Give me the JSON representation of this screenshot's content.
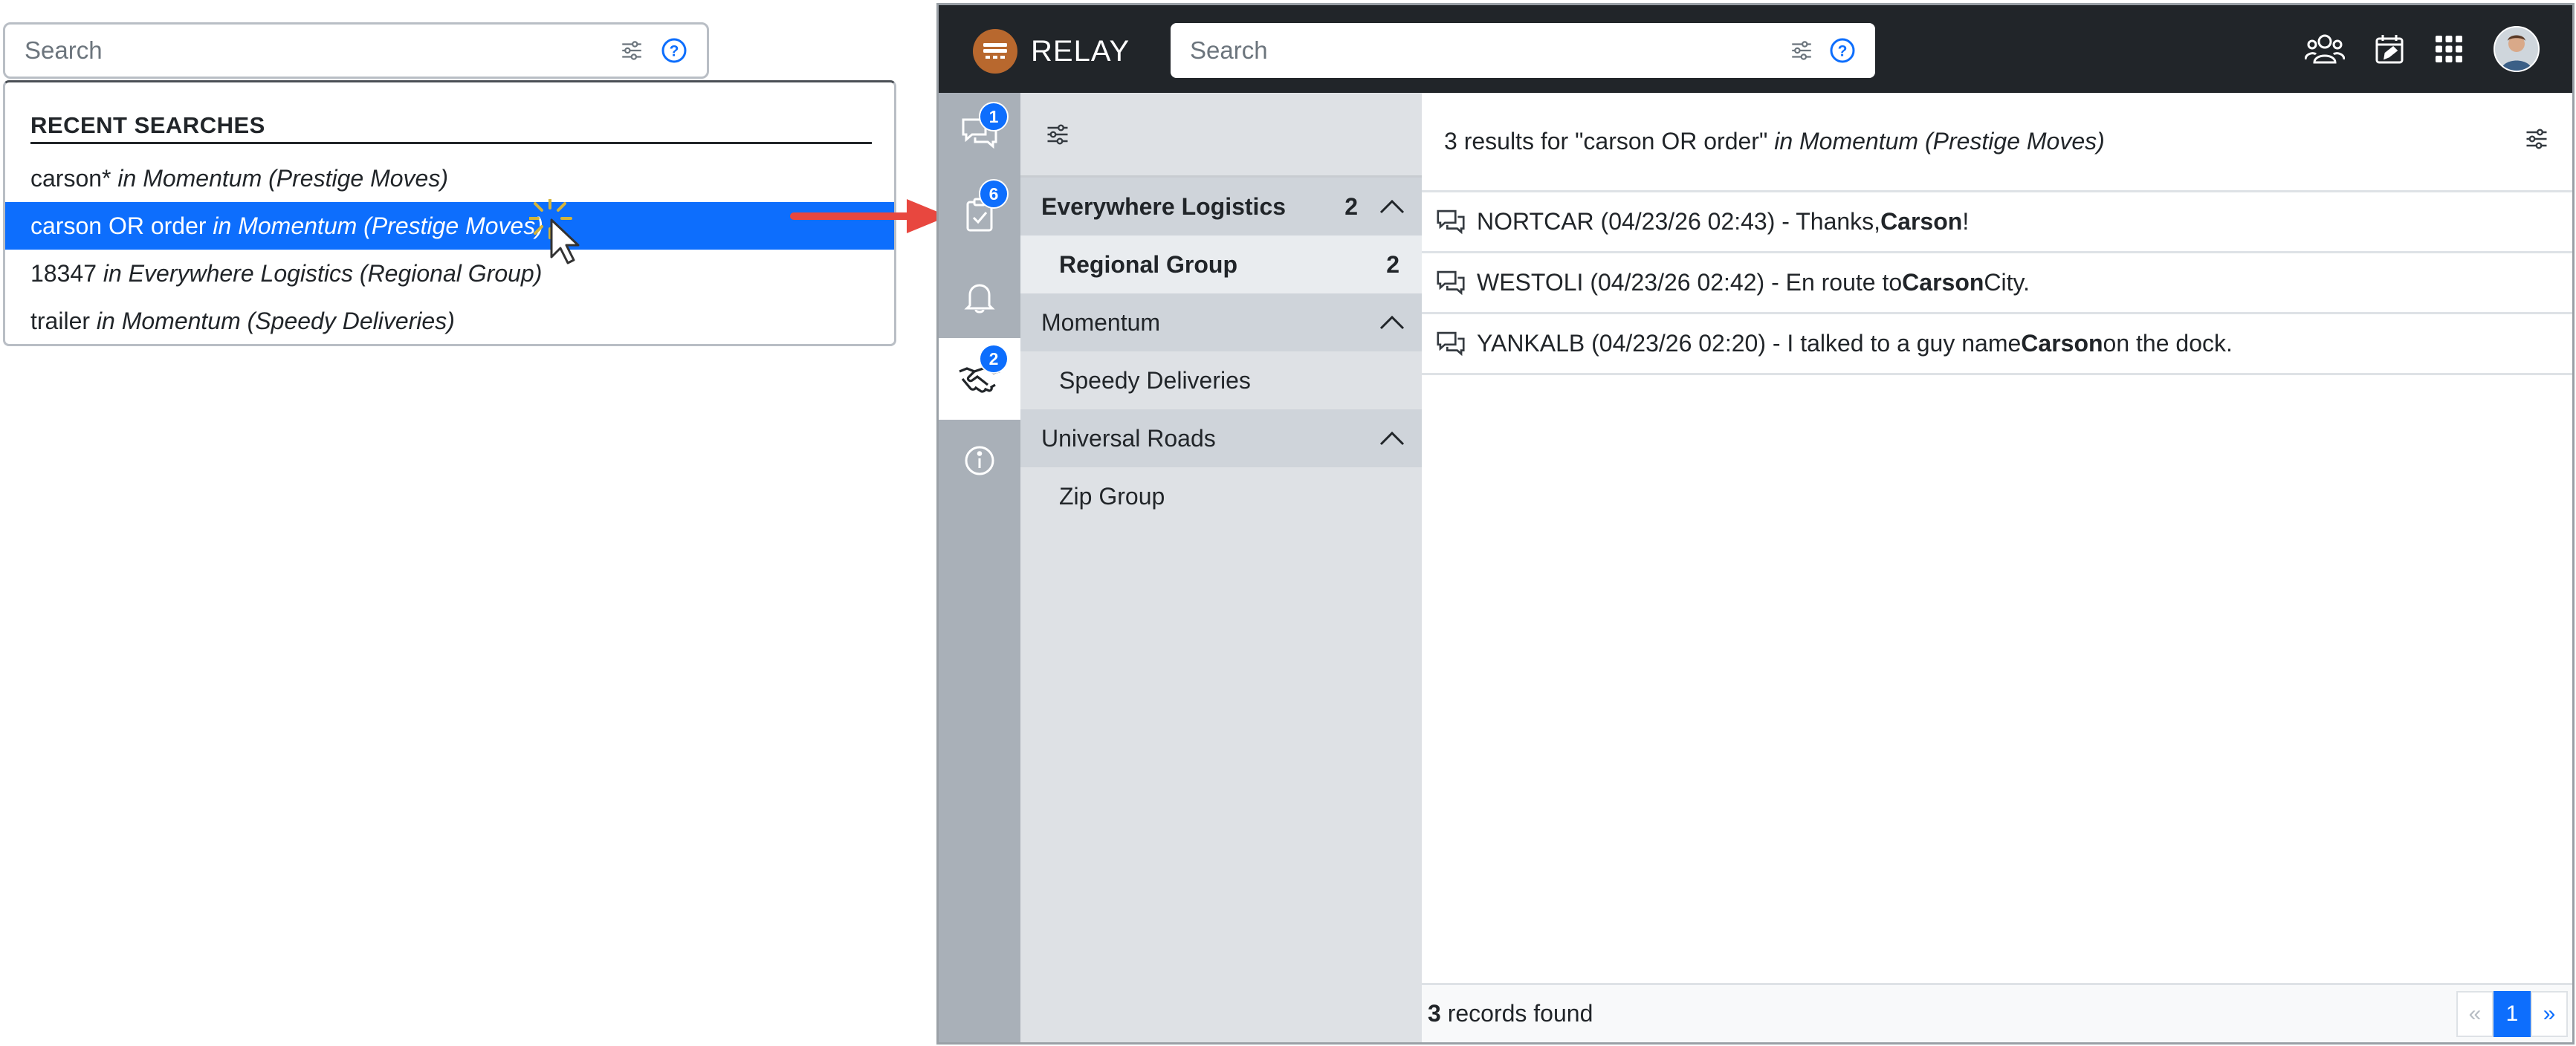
{
  "left_search": {
    "placeholder": "Search",
    "recent_header": "RECENT SEARCHES",
    "recent": [
      {
        "query": "carson*",
        "scope": "in Momentum (Prestige Moves)"
      },
      {
        "query": "carson OR order",
        "scope": "in Momentum (Prestige Moves)"
      },
      {
        "query": "18347",
        "scope": "in Everywhere Logistics (Regional Group)"
      },
      {
        "query": "trailer",
        "scope": "in Momentum (Speedy Deliveries)"
      }
    ],
    "active_index": 1
  },
  "app": {
    "brand": "RELAY",
    "search_placeholder": "Search",
    "rail_badges": {
      "messages": "1",
      "tasks": "6",
      "deals": "2"
    },
    "groups": [
      {
        "org": "Everywhere Logistics",
        "count": "2",
        "subs": [
          {
            "name": "Regional Group",
            "count": "2"
          }
        ]
      },
      {
        "org": "Momentum",
        "count": "",
        "subs": [
          {
            "name": "Speedy Deliveries",
            "count": ""
          }
        ]
      },
      {
        "org": "Universal Roads",
        "count": "",
        "subs": [
          {
            "name": "Zip Group",
            "count": ""
          }
        ]
      }
    ],
    "results_header": {
      "prefix": "3 results for \"carson OR order\"",
      "scope": "in Momentum (Prestige Moves)"
    },
    "results": [
      {
        "pre": "NORTCAR (04/23/26 02:43) - Thanks, ",
        "hl": "Carson",
        "post": "!"
      },
      {
        "pre": "WESTOLI (04/23/26 02:42) - En route to ",
        "hl": "Carson",
        "post": " City."
      },
      {
        "pre": "YANKALB (04/23/26 02:20) - I talked to a guy name ",
        "hl": "Carson",
        "post": " on the dock."
      }
    ],
    "footer": {
      "count": "3",
      "label": " records found"
    },
    "pager": {
      "prev": "«",
      "current": "1",
      "next": "»"
    }
  },
  "colors": {
    "accent": "#0d6efd",
    "topbar": "#212529",
    "rail": "#a9b0b8",
    "brand_logo": "#b8682e",
    "arrow": "#e8473f"
  }
}
